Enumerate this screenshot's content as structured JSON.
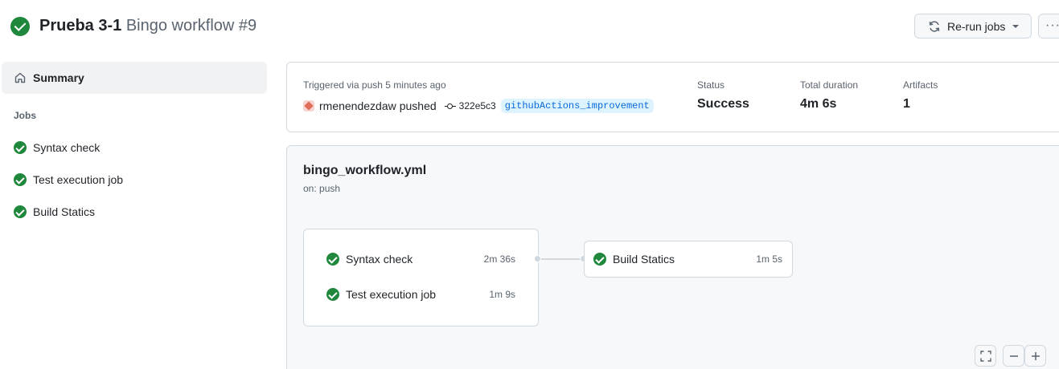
{
  "header": {
    "workflow_name": "Prueba 3-1",
    "run_title": "Bingo workflow #9",
    "rerun_label": "Re-run jobs",
    "more_label": "···"
  },
  "sidebar": {
    "summary_label": "Summary",
    "jobs_heading": "Jobs",
    "jobs": [
      {
        "label": "Syntax check"
      },
      {
        "label": "Test execution job"
      },
      {
        "label": "Build Statics"
      }
    ]
  },
  "summary": {
    "triggered_text": "Triggered via push 5 minutes ago",
    "actor": "rmenendezdaw",
    "action": "pushed",
    "commit_sha": "322e5c3",
    "branch": "githubActions_improvement",
    "status_label": "Status",
    "status_value": "Success",
    "duration_label": "Total duration",
    "duration_value": "4m 6s",
    "artifacts_label": "Artifacts",
    "artifacts_value": "1"
  },
  "workflow": {
    "file": "bingo_workflow.yml",
    "trigger": "on: push",
    "group_jobs": [
      {
        "label": "Syntax check",
        "duration": "2m 36s"
      },
      {
        "label": "Test execution job",
        "duration": "1m 9s"
      }
    ],
    "downstream_job": {
      "label": "Build Statics",
      "duration": "1m 5s"
    }
  },
  "colors": {
    "success": "#1f883d",
    "link": "#0969da",
    "muted": "#59636e"
  },
  "icons": {
    "status": "check-circle-icon",
    "rerun": "sync-icon",
    "summary": "home-icon",
    "commit": "git-commit-icon",
    "fullscreen": "screen-full-icon",
    "zoom_out": "dash-icon",
    "zoom_in": "plus-icon"
  }
}
